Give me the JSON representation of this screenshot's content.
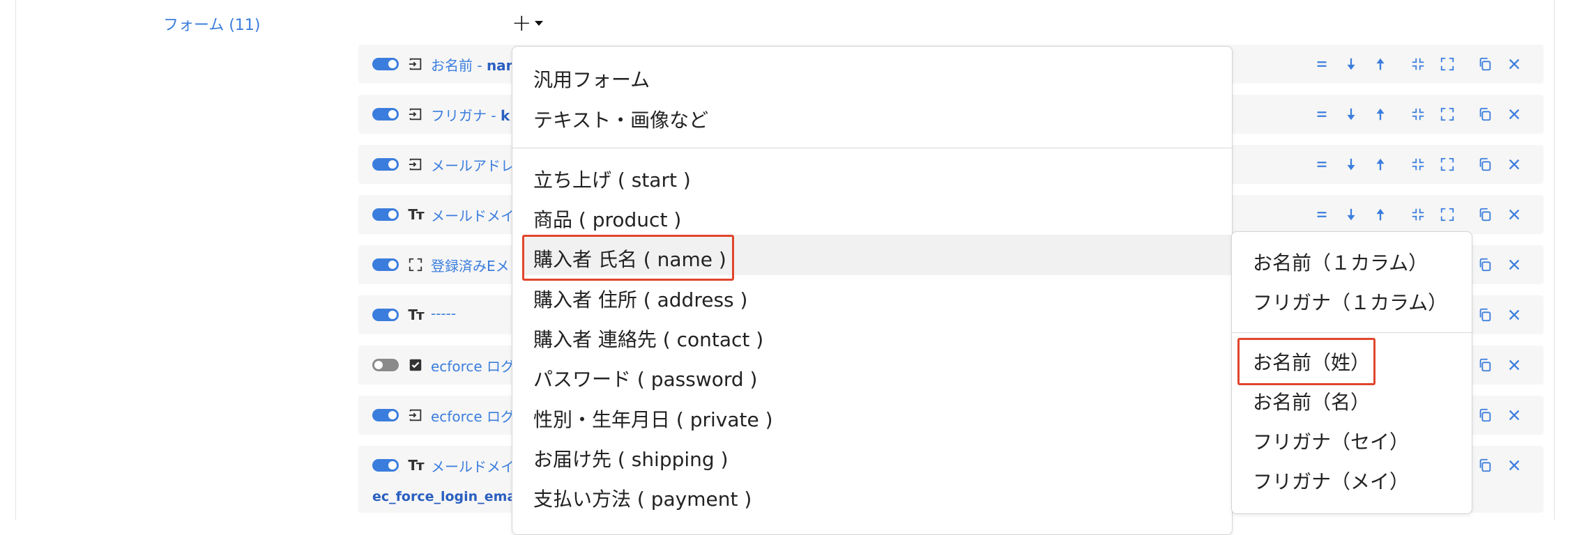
{
  "section": {
    "title": "フォーム (11)"
  },
  "rows": [
    {
      "label": "お名前 - ",
      "label_bold": "nam"
    },
    {
      "label": "フリガナ - ",
      "label_bold": "k"
    },
    {
      "label": "メールアドレ"
    },
    {
      "label": "メールドメイ"
    },
    {
      "label": "登録済みEメ"
    },
    {
      "label": "-----"
    },
    {
      "label": "ecforce ログ"
    },
    {
      "label": "ecforce ログ"
    },
    {
      "label": "メールドメイ",
      "sub": "ec_force_login_email"
    }
  ],
  "menu": {
    "items": [
      "汎用フォーム",
      "テキスト・画像など",
      "立ち上げ ( start )",
      "商品 ( product )",
      "購入者 氏名 ( name )",
      "購入者 住所 ( address )",
      "購入者 連絡先 ( contact )",
      "パスワード ( password )",
      "性別・生年月日 ( private )",
      "お届け先 ( shipping )",
      "支払い方法 ( payment )"
    ]
  },
  "submenu": {
    "items": [
      "お名前（１カラム）",
      "フリガナ（１カラム）",
      "お名前（姓）",
      "お名前（名）",
      "フリガナ（セイ）",
      "フリガナ（メイ）"
    ]
  },
  "icons": {
    "toggle": "toggle-switch-icon",
    "input": "input-field-icon",
    "text": "text-type-icon",
    "fullscreen": "fullscreen-icon",
    "checkbox": "checkbox-icon",
    "equal": "equal-icon",
    "down": "arrow-down-icon",
    "up": "arrow-up-icon",
    "collapse": "collapse-icon",
    "expand": "expand-icon",
    "copy": "copy-icon",
    "close": "close-icon"
  },
  "colors": {
    "accent": "#3b7ddd",
    "highlight": "#e0452b",
    "toggle_off": "#8a8a8a"
  }
}
